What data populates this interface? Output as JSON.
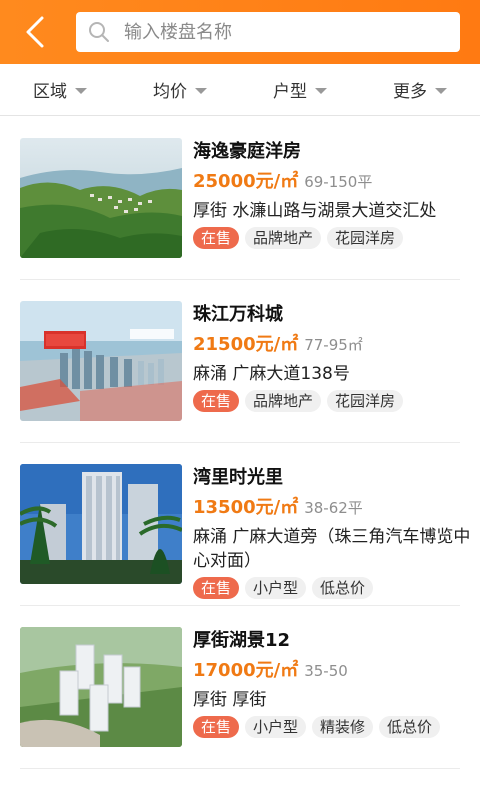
{
  "header": {
    "back_icon": "chevron-left-icon",
    "search_icon": "search-icon",
    "search_placeholder": "输入楼盘名称",
    "bar_color": "#ff8a1e"
  },
  "filters": [
    {
      "label": "区域"
    },
    {
      "label": "均价"
    },
    {
      "label": "户型"
    },
    {
      "label": "更多"
    }
  ],
  "listings": [
    {
      "name": "海逸豪庭洋房",
      "price": "25000元/㎡",
      "area": "69-150平",
      "address": "厚街 水濂山路与湖景大道交汇处",
      "tags": [
        "在售",
        "品牌地产",
        "花园洋房"
      ]
    },
    {
      "name": "珠江万科城",
      "price": "21500元/㎡",
      "area": "77-95㎡",
      "address": "麻涌 广麻大道138号",
      "tags": [
        "在售",
        "品牌地产",
        "花园洋房"
      ]
    },
    {
      "name": "湾里时光里",
      "price": "13500元/㎡",
      "area": "38-62平",
      "address": "麻涌 广麻大道旁（珠三角汽车博览中心对面）",
      "tags": [
        "在售",
        "小户型",
        "低总价"
      ]
    },
    {
      "name": "厚街湖景12",
      "price": "17000元/㎡",
      "area": "35-50",
      "address": "厚街 厚街",
      "tags": [
        "在售",
        "小户型",
        "精装修",
        "低总价"
      ]
    }
  ],
  "colors": {
    "price": "#f07a14",
    "status_tag": "#ee6a4c"
  }
}
